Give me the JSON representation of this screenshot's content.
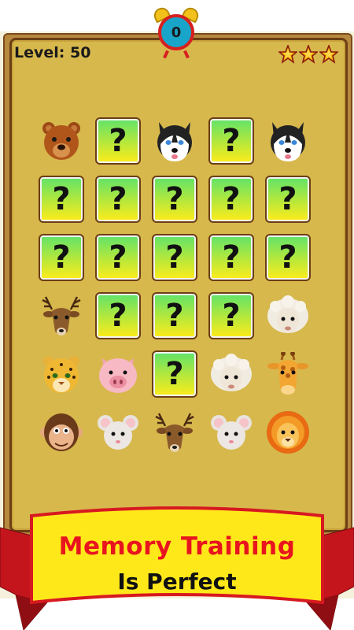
{
  "header": {
    "level_label": "Level: 50",
    "timer_value": "0",
    "stars_count": 3
  },
  "colors": {
    "panel": "#d7b84d",
    "card_top": "#5fe36a",
    "card_bottom": "#ffec1a",
    "banner": "#ffe81a",
    "ribbon": "#d71920",
    "title_red": "#e8141e"
  },
  "board": {
    "rows": [
      [
        "bear-icon",
        "hidden-card",
        "husky-icon",
        "hidden-card",
        "husky-icon"
      ],
      [
        "hidden-card",
        "hidden-card",
        "hidden-card",
        "hidden-card",
        "hidden-card"
      ],
      [
        "hidden-card",
        "hidden-card",
        "hidden-card",
        "hidden-card",
        "hidden-card"
      ],
      [
        "deer-icon",
        "hidden-card",
        "hidden-card",
        "hidden-card",
        "sheep-icon"
      ],
      [
        "leopard-icon",
        "pig-icon",
        "hidden-card",
        "sheep-icon",
        "giraffe-icon"
      ],
      [
        "monkey-icon",
        "mouse-icon",
        "deer-icon",
        "mouse-icon",
        "lion-icon"
      ]
    ],
    "hidden_symbol": "?"
  },
  "banner": {
    "line1": "Memory Training",
    "line2": "Is Perfect"
  }
}
